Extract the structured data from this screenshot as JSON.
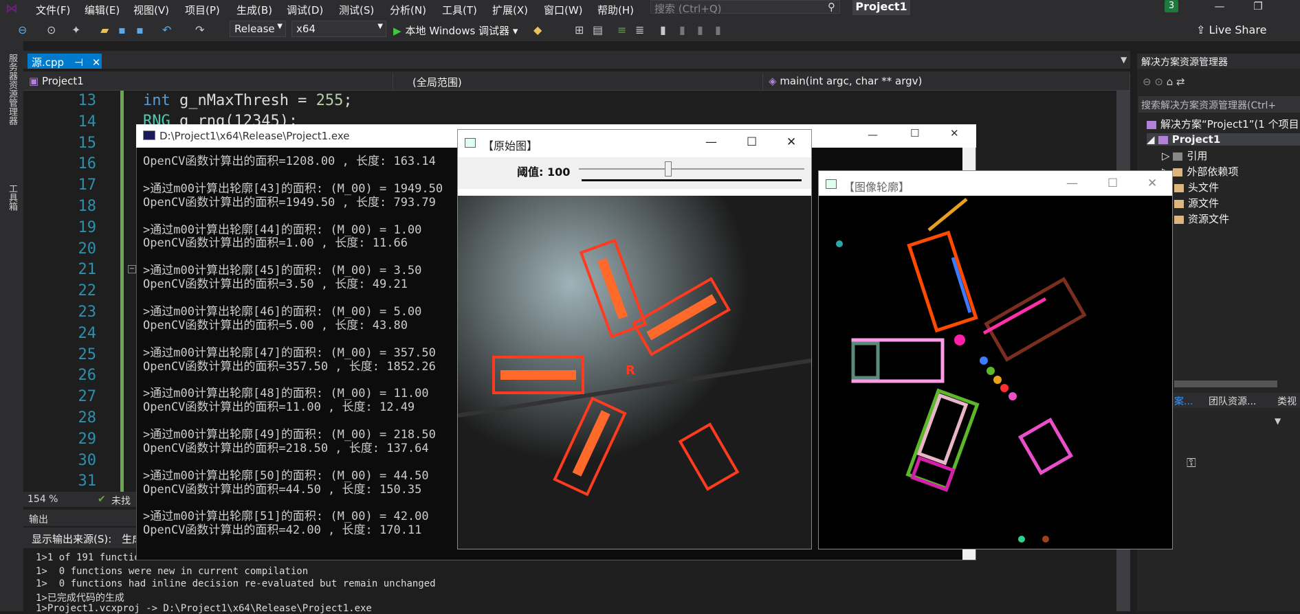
{
  "menubar": {
    "items": [
      "文件(F)",
      "编辑(E)",
      "视图(V)",
      "项目(P)",
      "生成(B)",
      "调试(D)",
      "测试(S)",
      "分析(N)",
      "工具(T)",
      "扩展(X)",
      "窗口(W)",
      "帮助(H)"
    ],
    "search_placeholder": "搜索 (Ctrl+Q)",
    "project_title": "Project1",
    "notification_count": "3"
  },
  "toolbar": {
    "config": "Release",
    "platform": "x64",
    "run_label": "本地 Windows 调试器",
    "live_share": "Live Share"
  },
  "leftstrip": {
    "server_explorer": "服务器资源管理器",
    "toolbox": "工具箱"
  },
  "tabs": {
    "active_file": "源.cpp"
  },
  "navbar": {
    "project": "Project1",
    "scope": "(全局范围)",
    "member": "main(int argc, char ** argv)"
  },
  "editor": {
    "line_numbers": [
      "13",
      "14",
      "15",
      "16",
      "17",
      "18",
      "19",
      "20",
      "21",
      "22",
      "23",
      "24",
      "25",
      "26",
      "27",
      "28",
      "29",
      "30",
      "31"
    ],
    "line13": {
      "kw": "int",
      "name": " g_nMaxThresh = ",
      "num": "255",
      "end": ";"
    },
    "line14": {
      "ty": "RNG",
      "rest": " g_rng(12345);"
    },
    "zoom": "154 %",
    "status": "未找"
  },
  "output": {
    "header": "输出",
    "source_label": "显示输出来源(S):",
    "source_value": "生成",
    "lines": [
      "1>1 of 191 functio",
      "1>  0 functions were new in current compilation",
      "1>  0 functions had inline decision re-evaluated but remain unchanged",
      "1>已完成代码的生成",
      "1>Project1.vcxproj -> D:\\Project1\\x64\\Release\\Project1.exe"
    ]
  },
  "solution_explorer": {
    "title": "解决方案资源管理器",
    "search_placeholder": "搜索解决方案资源管理器(Ctrl+",
    "solution": "解决方案“Project1”(1 个项目",
    "project": "Project1",
    "items": [
      "引用",
      "外部依赖项",
      "头文件",
      "源文件",
      "资源文件"
    ],
    "bottom_tabs": [
      "案...",
      "团队资源...",
      "类视"
    ]
  },
  "console": {
    "title": "D:\\Project1\\x64\\Release\\Project1.exe",
    "lines": [
      "OpenCV函数计算出的面积=1208.00 , 长度: 163.14",
      "",
      ">通过m00计算出轮廓[43]的面积: (M_00) = 1949.50",
      "OpenCV函数计算出的面积=1949.50 , 长度: 793.79",
      "",
      ">通过m00计算出轮廓[44]的面积: (M_00) = 1.00",
      "OpenCV函数计算出的面积=1.00 , 长度: 11.66",
      "",
      ">通过m00计算出轮廓[45]的面积: (M_00) = 3.50",
      "OpenCV函数计算出的面积=3.50 , 长度: 49.21",
      "",
      ">通过m00计算出轮廓[46]的面积: (M_00) = 5.00",
      "OpenCV函数计算出的面积=5.00 , 长度: 43.80",
      "",
      ">通过m00计算出轮廓[47]的面积: (M_00) = 357.50",
      "OpenCV函数计算出的面积=357.50 , 长度: 1852.26",
      "",
      ">通过m00计算出轮廓[48]的面积: (M_00) = 11.00",
      "OpenCV函数计算出的面积=11.00 , 长度: 12.49",
      "",
      ">通过m00计算出轮廓[49]的面积: (M_00) = 218.50",
      "OpenCV函数计算出的面积=218.50 , 长度: 137.64",
      "",
      ">通过m00计算出轮廓[50]的面积: (M_00) = 44.50",
      "OpenCV函数计算出的面积=44.50 , 长度: 150.35",
      "",
      ">通过m00计算出轮廓[51]的面积: (M_00) = 42.00",
      "OpenCV函数计算出的面积=42.00 , 长度: 170.11"
    ]
  },
  "original_window": {
    "title": "【原始图】",
    "slider_label": "阈值: 100",
    "slider_value": 100,
    "slider_max": 255
  },
  "contour_window": {
    "title": "【图像轮廓】"
  },
  "colors": {
    "accent": "#007acc",
    "ide_bg": "#1e1e1e",
    "chrome": "#2d2d30",
    "contour_red": "#ff3b1f"
  }
}
